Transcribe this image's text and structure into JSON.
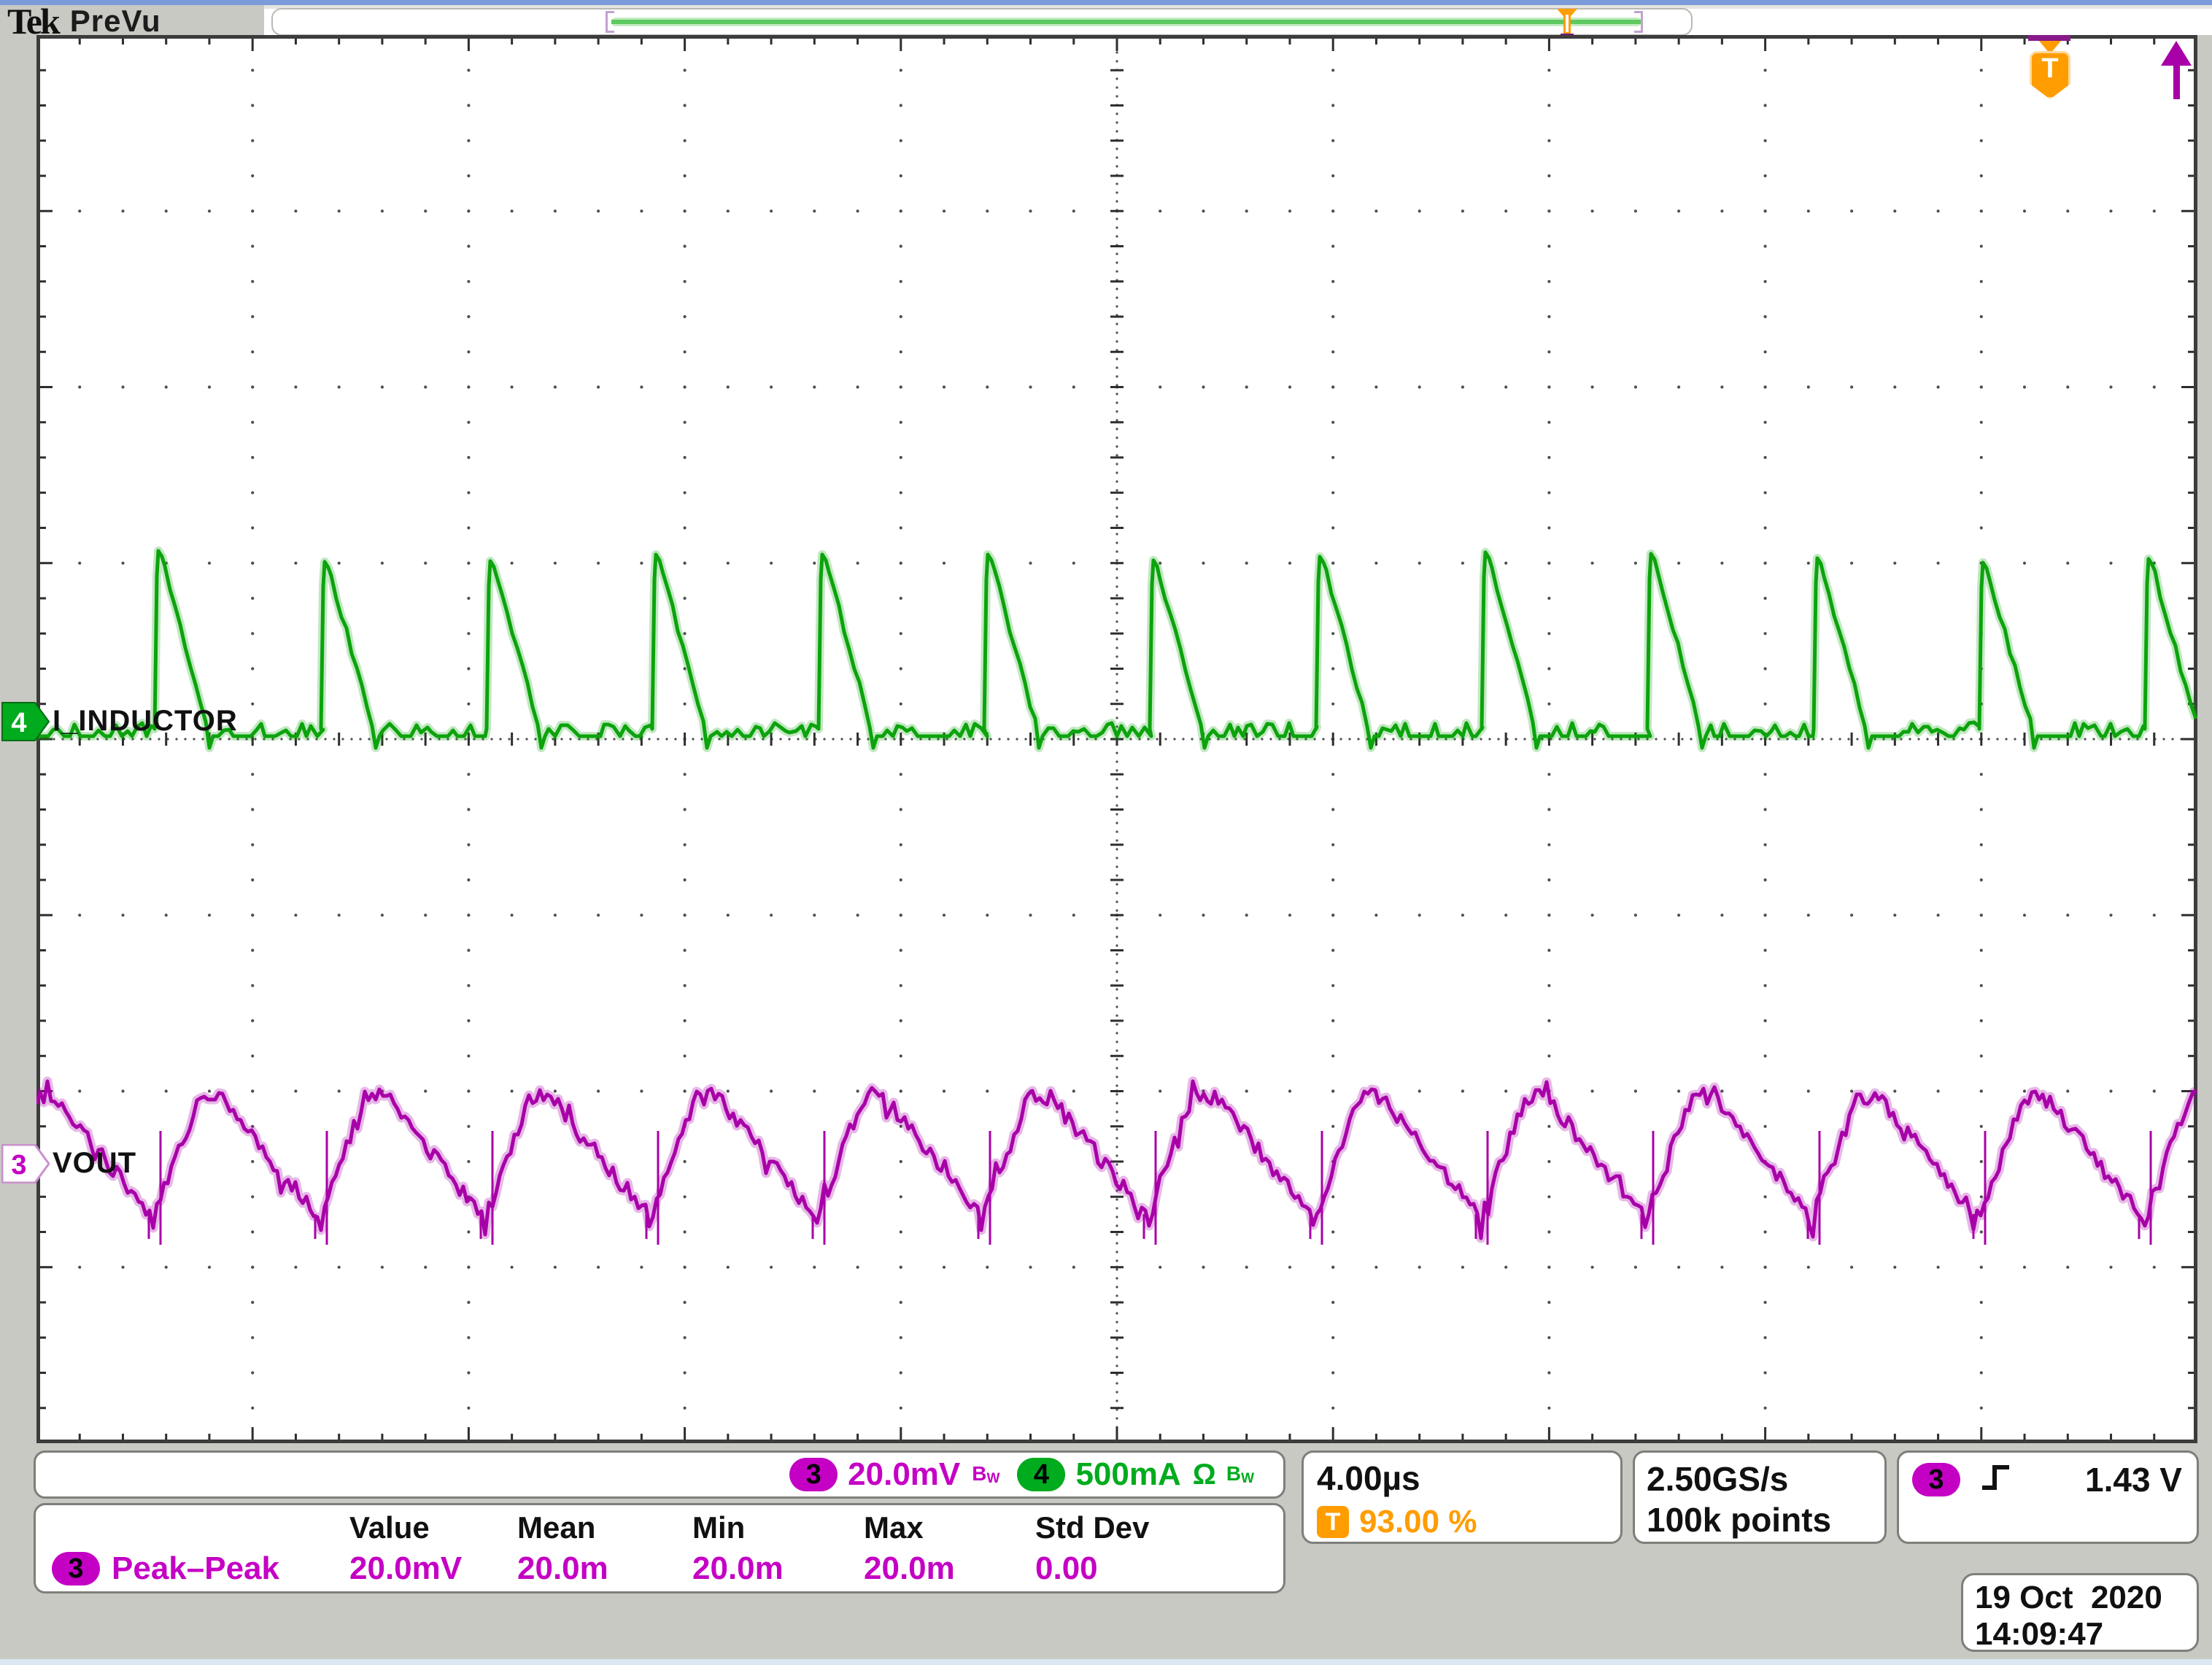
{
  "colors": {
    "ch3": "#c400c4",
    "ch3-wave": "#a800a8",
    "ch4": "#00ab1d",
    "ch4-wave": "#0ca30c",
    "trig": "#ff9d00",
    "blue": "#7b9bd9"
  },
  "header": {
    "logo": "Tek",
    "mode": "PreVu"
  },
  "channels": {
    "ch3": {
      "badge": "3",
      "label": "VOUT",
      "scale": "20.0mV",
      "bw_b": "B",
      "bw_w": "W"
    },
    "ch4": {
      "badge": "4",
      "label": "I_INDUCTOR",
      "scale": "500mA",
      "ohm": "Ω",
      "bw_b": "B",
      "bw_w": "W"
    }
  },
  "timebase": {
    "scale": "4.00µs",
    "trigger_icon": "T",
    "trigger_position": "93.00 %"
  },
  "acquisition": {
    "sample_rate": "2.50GS/s",
    "record_length": "100k points"
  },
  "trigger": {
    "source_badge": "3",
    "slope": "rising",
    "level": "1.43 V",
    "marker_letter": "T"
  },
  "measurements": {
    "col_value": "Value",
    "col_mean": "Mean",
    "col_min": "Min",
    "col_max": "Max",
    "col_stddev": "Std Dev",
    "rows": [
      {
        "badge": "3",
        "name": "Peak–Peak",
        "value": "20.0mV",
        "mean": "20.0m",
        "min": "20.0m",
        "max": "20.0m",
        "stddev": "0.00"
      }
    ]
  },
  "datetime": {
    "date": "19 Oct  2020",
    "time": "14:09:47"
  },
  "chart_data": {
    "type": "line",
    "instrument": "oscilloscope-display",
    "title": "",
    "time_per_div_us": 4.0,
    "divisions": {
      "x": 10,
      "y": 8
    },
    "grid": "dotted divisions with center crosshair ticks",
    "series": [
      {
        "name": "I_INDUCTOR",
        "channel": 4,
        "color_key": "ch4-wave",
        "vertical_scale": "500mA/div",
        "coupling": "Ω Bw",
        "shape": "discontinuous-mode inductor current: sharp rise, linear ramp-down, flat noisy baseline",
        "period_us": 3.07,
        "first_rise_us": 2.2,
        "baseline_div_from_center": 0.0,
        "peak_div_above_baseline": 1.02,
        "peak_value_mA": 500,
        "rise_frac": 0.02,
        "fall_frac": 0.33,
        "baseline_noise_div": 0.05,
        "pulses_visible": 13
      },
      {
        "name": "VOUT",
        "channel": 3,
        "color_key": "ch3-wave",
        "vertical_scale": "20.0mV/div",
        "coupling": "Bw",
        "shape": "output ripple sawtooth: fast rise, rounded top, slow decay with dip",
        "period_us": 3.07,
        "first_trough_us": 2.2,
        "center_div_below_center": 2.36,
        "amplitude_div": 0.34,
        "peak_to_peak_mV": 20,
        "rise_frac": 0.27,
        "plateau_frac": 0.12,
        "noise_div": 0.045
      }
    ],
    "trigger": {
      "source_channel": 3,
      "slope": "rising",
      "level_V": 1.43,
      "position_pct": 93.0
    },
    "record": {
      "sample_rate": "2.50GS/s",
      "length_points": 100000
    }
  }
}
